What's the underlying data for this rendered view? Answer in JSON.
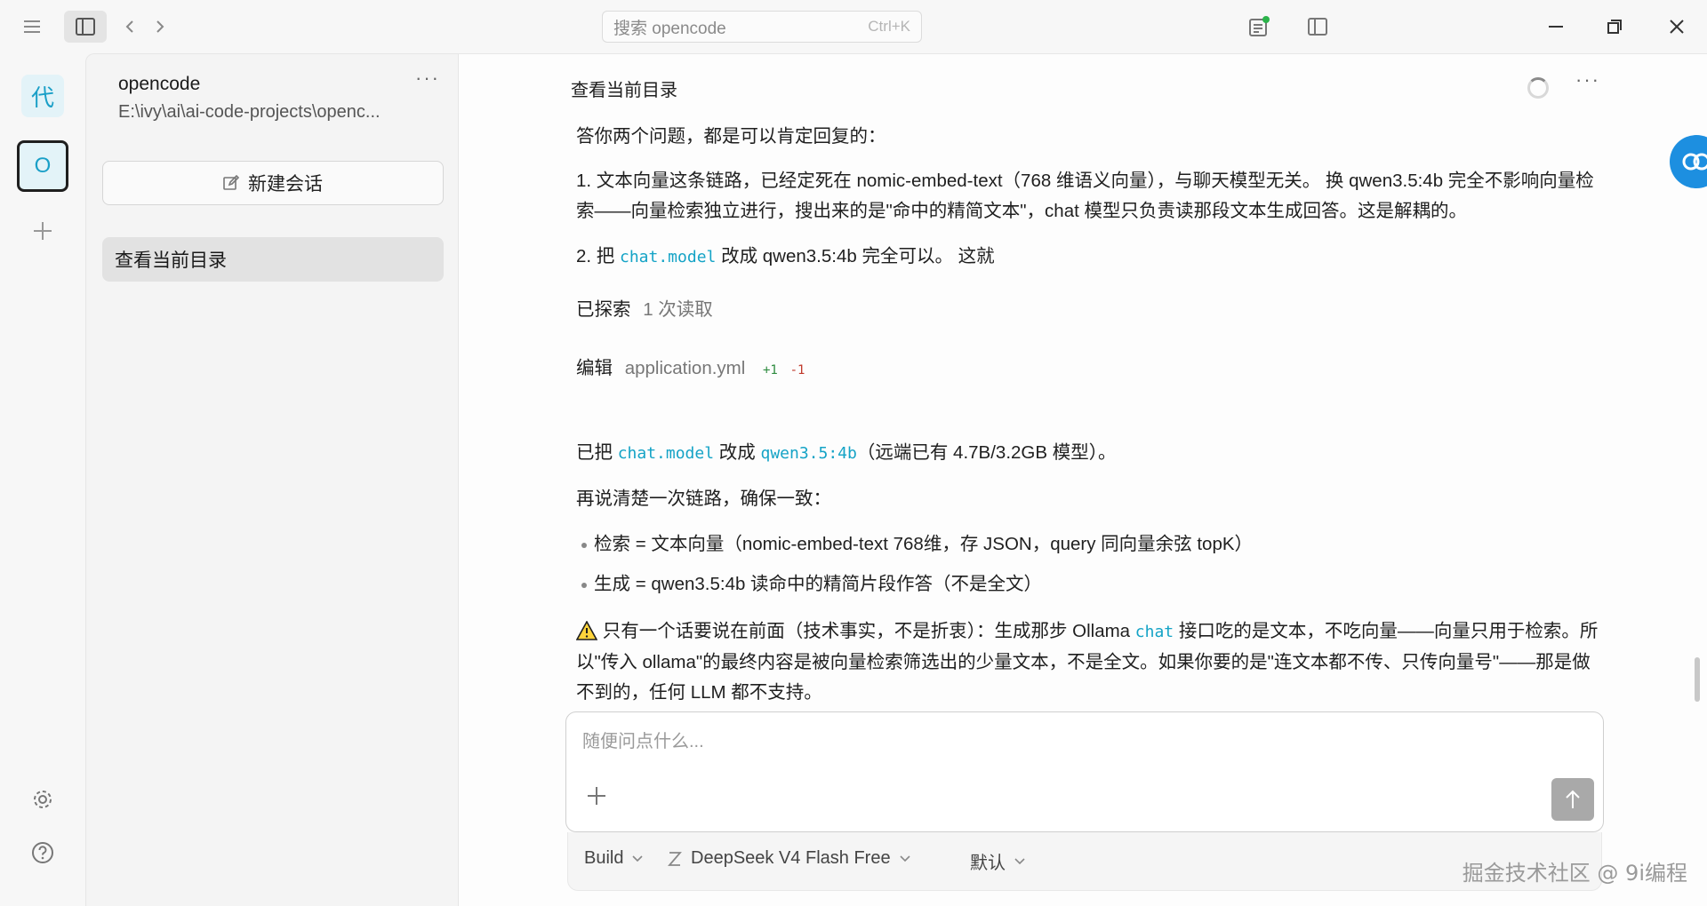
{
  "titlebar": {
    "search_placeholder": "搜索 opencode",
    "search_shortcut": "Ctrl+K"
  },
  "rail": {
    "project_avatar": "代",
    "active_project": "O"
  },
  "sidebar": {
    "project_name": "opencode",
    "project_path": "E:\\ivy\\ai\\ai-code-projects\\openc...",
    "more": "···",
    "new_session_label": "新建会话",
    "sessions": [
      {
        "label": "查看当前目录"
      }
    ]
  },
  "main": {
    "title": "查看当前目录",
    "more": "···",
    "messages": {
      "intro": "答你两个问题，都是可以肯定回复的：",
      "point1": "1. 文本向量这条链路，已经定死在 nomic-embed-text（768 维语义向量），与聊天模型无关。 换 qwen3.5:4b 完全不影响向量检索——向量检索独立进行，搜出来的是\"命中的精简文本\"，chat 模型只负责读那段文本生成回答。这是解耦的。",
      "point2_prefix": "2. 把 ",
      "point2_code": "chat.model",
      "point2_suffix": " 改成 qwen3.5:4b 完全可以。 这就",
      "explored_label": "已探索",
      "explored_detail": "1 次读取",
      "edit_label": "编辑",
      "edit_file": "application.yml",
      "edit_add": "+1",
      "edit_del": "-1",
      "changed_prefix": "已把 ",
      "changed_code1": "chat.model",
      "changed_mid": " 改成 ",
      "changed_code2": "qwen3.5:4b",
      "changed_suffix": "（远端已有 4.7B/3.2GB 模型）。",
      "recap": "再说清楚一次链路，确保一致：",
      "bullets": [
        "检索 = 文本向量（nomic-embed-text 768维，存 JSON，query 同向量余弦 topK）",
        "生成 = qwen3.5:4b 读命中的精简片段作答（不是全文）"
      ],
      "warning_prefix": " 只有一个话要说在前面（技术事实，不是折衷）：生成那步 Ollama ",
      "warning_code": "chat",
      "warning_suffix": " 接口吃的是文本，不吃向量——向量只用于检索。所以\"传入 ollama\"的最终内容是被向量检索筛选出的少量文本，不是全文。如果你要的是\"连文本都不传、只传向量号\"——那是做不到的，任何 LLM 都不支持。"
    },
    "composer": {
      "placeholder": "随便问点什么...",
      "agent": "Build",
      "model": "DeepSeek V4 Flash Free",
      "variant": "默认"
    }
  },
  "watermark": "掘金技术社区 @ 9i编程",
  "colors": {
    "accent": "#14a3c6",
    "add": "#2e8b3f",
    "del": "#c0392b"
  }
}
